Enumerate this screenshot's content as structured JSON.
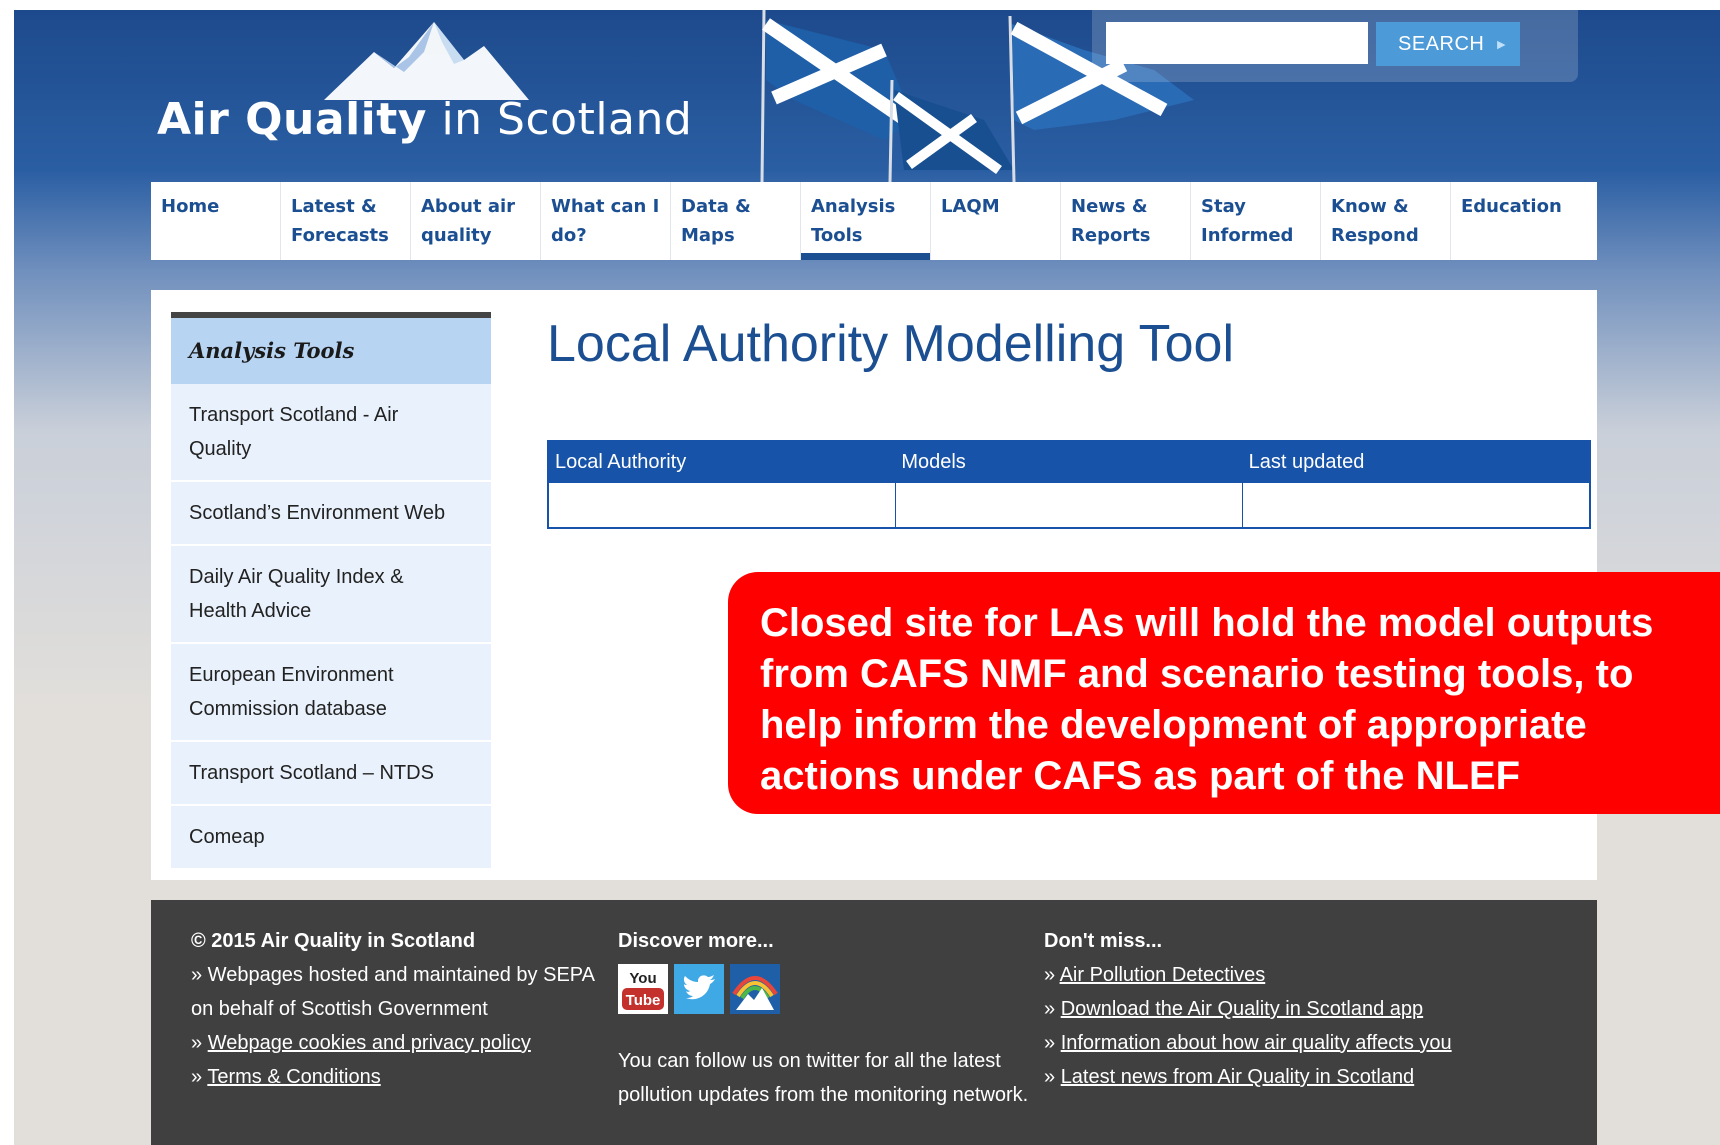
{
  "header": {
    "logo_bold": "Air Quality",
    "logo_rest": " in Scotland",
    "search_placeholder": "",
    "search_button": "SEARCH"
  },
  "nav": [
    {
      "label_line1": "Home",
      "label_line2": ""
    },
    {
      "label_line1": "Latest &",
      "label_line2": "Forecasts"
    },
    {
      "label_line1": "About air",
      "label_line2": "quality"
    },
    {
      "label_line1": "What can I",
      "label_line2": "do?"
    },
    {
      "label_line1": "Data &",
      "label_line2": "Maps"
    },
    {
      "label_line1": "Analysis",
      "label_line2": "Tools"
    },
    {
      "label_line1": "LAQM",
      "label_line2": ""
    },
    {
      "label_line1": "News &",
      "label_line2": "Reports"
    },
    {
      "label_line1": "Stay",
      "label_line2": "Informed"
    },
    {
      "label_line1": "Know &",
      "label_line2": "Respond"
    },
    {
      "label_line1": "Education",
      "label_line2": ""
    }
  ],
  "sidebar": {
    "title": "Analysis Tools",
    "items": [
      {
        "line1": "Transport Scotland - Air",
        "line2": "Quality"
      },
      {
        "line1": "Scotland’s Environment Web",
        "line2": ""
      },
      {
        "line1": "Daily Air Quality Index &",
        "line2": "Health Advice"
      },
      {
        "line1": "European Environment",
        "line2": "Commission database"
      },
      {
        "line1": "Transport Scotland – NTDS",
        "line2": ""
      },
      {
        "line1": "Comeap",
        "line2": ""
      }
    ]
  },
  "main": {
    "title": "Local Authority Modelling Tool",
    "table_headers": [
      "Local Authority",
      "Models",
      "Last updated"
    ]
  },
  "callout": {
    "lines": [
      "Closed site for LAs will hold the model outputs",
      "from CAFS NMF and scenario testing tools, to",
      "help inform the development of appropriate",
      "actions under CAFS as part of the NLEF"
    ]
  },
  "footer": {
    "col1": {
      "heading": "© 2015 Air Quality in Scotland",
      "line1": "» Webpages hosted and maintained by SEPA",
      "line2": "on behalf of Scottish Government",
      "link_prefix": "» ",
      "link1": "Webpage cookies and privacy policy",
      "link2": "Terms & Conditions"
    },
    "col2": {
      "heading": "Discover more...",
      "follow_text": "You can follow us on twitter for all the latest pollution updates from the monitoring network.",
      "youtube_top": "You",
      "youtube_bottom": "Tube"
    },
    "col3": {
      "heading": "Don't miss...",
      "link_prefix": "» ",
      "links": [
        "Air Pollution Detectives",
        "Download the Air Quality in Scotland app",
        "Information about how air quality affects you",
        "Latest news from Air Quality in Scotland"
      ]
    }
  }
}
